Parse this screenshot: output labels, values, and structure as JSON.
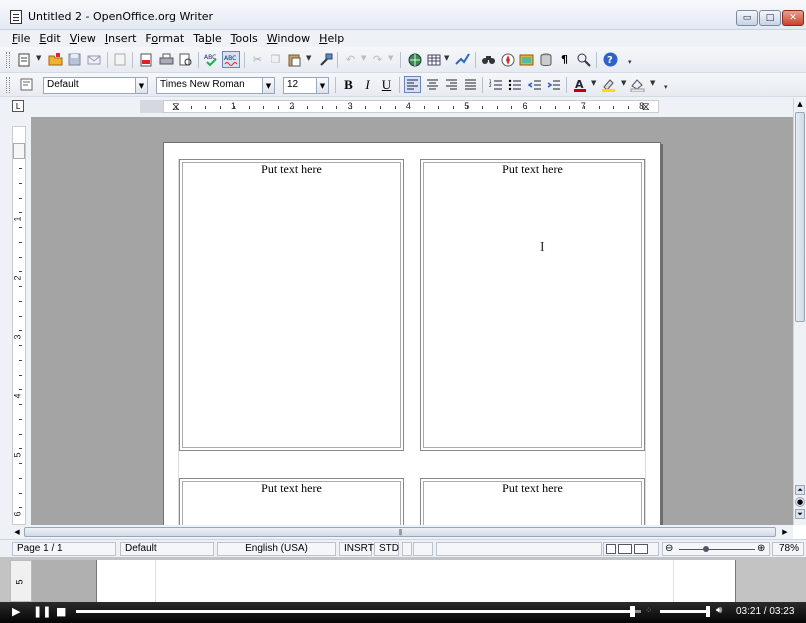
{
  "window": {
    "title": "Untitled 2 - OpenOffice.org Writer",
    "min_glyph": "▭",
    "max_glyph": "□",
    "close_glyph": "✕"
  },
  "menu": [
    {
      "label": "File",
      "accel": "F",
      "rest": "ile"
    },
    {
      "label": "Edit",
      "accel": "E",
      "rest": "dit"
    },
    {
      "label": "View",
      "accel": "V",
      "rest": "iew"
    },
    {
      "label": "Insert",
      "accel": "I",
      "rest": "nsert"
    },
    {
      "label": "Format",
      "accel": "o",
      "pre": "F",
      "rest": "rmat"
    },
    {
      "label": "Table",
      "accel": "b",
      "pre": "Ta",
      "rest": "le"
    },
    {
      "label": "Tools",
      "accel": "T",
      "rest": "ools"
    },
    {
      "label": "Window",
      "accel": "W",
      "rest": "indow"
    },
    {
      "label": "Help",
      "accel": "H",
      "rest": "elp"
    }
  ],
  "formatting": {
    "style": "Default",
    "font": "Times New Roman",
    "size": "12",
    "bold": "B",
    "italic": "I",
    "underline": "U"
  },
  "ruler": {
    "h_numbers": [
      "1",
      "2",
      "3",
      "4",
      "5",
      "6",
      "7",
      "8"
    ],
    "v_numbers": [
      "1",
      "2",
      "3",
      "4",
      "5",
      "6"
    ],
    "corner_glyph": "L"
  },
  "document": {
    "labels": [
      "Put text here",
      "Put text here",
      "Put text here",
      "Put text here"
    ]
  },
  "statusbar": {
    "page": "Page 1 / 1",
    "style": "Default",
    "language": "English (USA)",
    "insert_mode": "INSRT",
    "selection_mode": "STD",
    "zoom": "78%"
  },
  "strip": {
    "ruler_number": "5"
  },
  "player": {
    "time": "03:21 / 03:23",
    "progress_fraction": 0.99,
    "volume_fraction": 1.0
  },
  "colors": {
    "doc_background": "#a4a4a4",
    "page": "#ffffff",
    "font_color_icon": "#c00000",
    "highlight_icon": "#f7e000"
  }
}
